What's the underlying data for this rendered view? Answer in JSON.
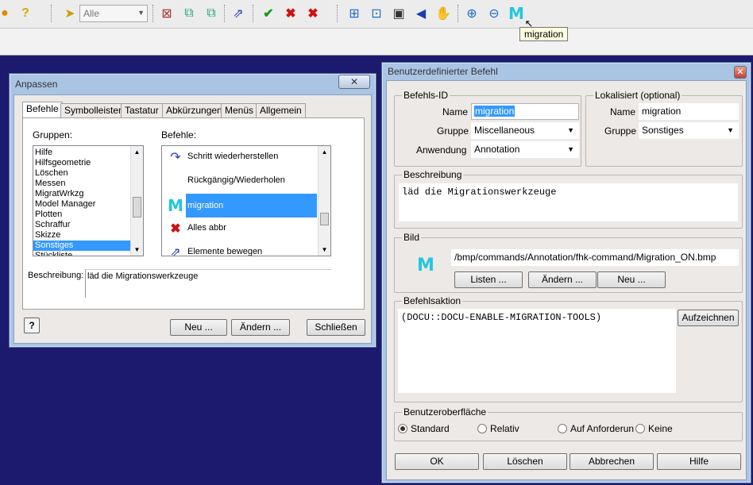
{
  "toolbar": {
    "filter_value": "Alle",
    "tooltip": "migration",
    "icons": [
      "info-icon",
      "help-icon",
      "select-arrow-icon",
      "delete-icon",
      "copy-icon",
      "paste-icon",
      "move-icon",
      "check-icon",
      "cancel-icon",
      "cancel-all-icon",
      "zoom-fit-icon",
      "zoom-window-icon",
      "view-icon",
      "back-icon",
      "pan-icon",
      "zoom-in-icon",
      "zoom-out-icon",
      "migration-icon"
    ]
  },
  "anpassen": {
    "title": "Anpassen",
    "tabs": [
      "Befehle",
      "Symbolleisten",
      "Tastatur",
      "Abkürzungen",
      "Menüs",
      "Allgemein"
    ],
    "groups_label": "Gruppen:",
    "commands_label": "Befehle:",
    "groups": [
      "Hilfe",
      "Hilfsgeometrie",
      "Löschen",
      "Messen",
      "MigratWrkzg",
      "Model Manager",
      "Plotten",
      "Schraffur",
      "Skizze",
      "Sonstiges",
      "Stückliste"
    ],
    "selected_group": "Sonstiges",
    "commands": [
      {
        "icon": "redo-icon",
        "label": "Schritt wiederherstellen"
      },
      {
        "icon": "",
        "label": "Rückgängig/Wiederholen"
      },
      {
        "icon": "migration-icon",
        "label": "migration"
      },
      {
        "icon": "cancel-all-icon",
        "label": "Alles abbr"
      },
      {
        "icon": "move-icon",
        "label": "Elemente bewegen"
      }
    ],
    "description_label": "Beschreibung:",
    "description": "läd die Migrationswerkzeuge",
    "buttons": {
      "new": "Neu ...",
      "change": "Ändern ...",
      "close": "Schließen"
    }
  },
  "befehl": {
    "title": "Benutzerdefinierter Befehl",
    "id_group": {
      "label": "Befehls-ID",
      "name_label": "Name",
      "name_value": "migration",
      "group_label": "Gruppe",
      "group_value": "Miscellaneous",
      "app_label": "Anwendung",
      "app_value": "Annotation"
    },
    "localized_group": {
      "label": "Lokalisiert (optional)",
      "name_label": "Name",
      "name_value": "migration",
      "group_label": "Gruppe",
      "group_value": "Sonstiges"
    },
    "description": {
      "label": "Beschreibung",
      "value": "läd die Migrationswerkzeuge"
    },
    "image": {
      "label": "Bild",
      "path": "/bmp/commands/Annotation/fhk-command/Migration_ON.bmp",
      "buttons": {
        "list": "Listen ...",
        "change": "Ändern ...",
        "new": "Neu ..."
      }
    },
    "action": {
      "label": "Befehlsaktion",
      "value": "(DOCU::DOCU-ENABLE-MIGRATION-TOOLS)",
      "record": "Aufzeichnen"
    },
    "ui": {
      "label": "Benutzeroberfläche",
      "options": [
        "Standard",
        "Relativ",
        "Auf Anforderun",
        "Keine"
      ],
      "selected": "Standard"
    },
    "buttons": {
      "ok": "OK",
      "delete": "Löschen",
      "cancel": "Abbrechen",
      "help": "Hilfe"
    }
  }
}
